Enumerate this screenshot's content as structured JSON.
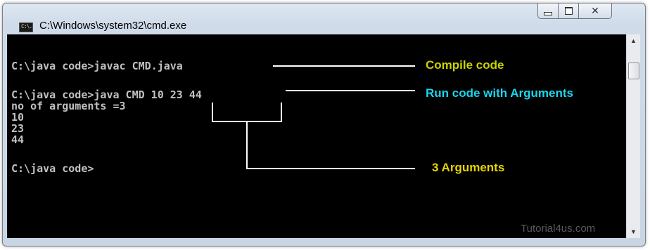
{
  "window": {
    "title": "C:\\Windows\\system32\\cmd.exe",
    "icon_text": "C:\\.",
    "controls": {
      "minimize": "minimize",
      "maximize": "maximize",
      "close": "✕"
    }
  },
  "console": {
    "lines": [
      "C:\\java code>javac CMD.java",
      "C:\\java code>java CMD 10 23 44",
      "no of arguments =3",
      "10",
      "23",
      "44",
      "C:\\java code>"
    ]
  },
  "annotations": {
    "compile": "Compile code",
    "run": "Run code with Arguments",
    "args": "3 Arguments"
  },
  "colors": {
    "compile": "#c8d400",
    "run": "#18d6ee",
    "args": "#e8d400",
    "console_text": "#c0c0c0"
  },
  "watermark": "Tutorial4us.com"
}
